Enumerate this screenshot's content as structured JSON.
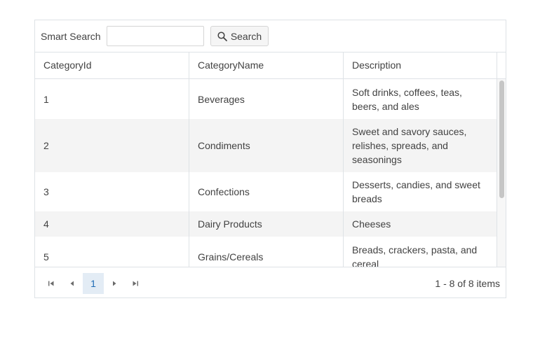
{
  "toolbar": {
    "search_label": "Smart Search",
    "search_value": "",
    "search_placeholder": "",
    "search_button_label": "Search",
    "search_button_icon": "search-icon"
  },
  "columns": [
    "CategoryId",
    "CategoryName",
    "Description"
  ],
  "rows": [
    {
      "id": "1",
      "name": "Beverages",
      "description": "Soft drinks, coffees, teas, beers, and ales"
    },
    {
      "id": "2",
      "name": "Condiments",
      "description": "Sweet and savory sauces, relishes, spreads, and seasonings"
    },
    {
      "id": "3",
      "name": "Confections",
      "description": "Desserts, candies, and sweet breads"
    },
    {
      "id": "4",
      "name": "Dairy Products",
      "description": "Cheeses"
    },
    {
      "id": "5",
      "name": "Grains/Cereals",
      "description": "Breads, crackers, pasta, and cereal"
    }
  ],
  "pager": {
    "first_icon": "first-page-icon",
    "prev_icon": "previous-page-icon",
    "next_icon": "next-page-icon",
    "last_icon": "last-page-icon",
    "current_page": "1",
    "info": "1 - 8 of 8 items"
  },
  "colors": {
    "border": "#dee2e6",
    "alt_row": "#f4f4f4",
    "text": "#424242",
    "page_active_bg": "#e3ecf5",
    "page_active_text": "#1f6cb5"
  }
}
